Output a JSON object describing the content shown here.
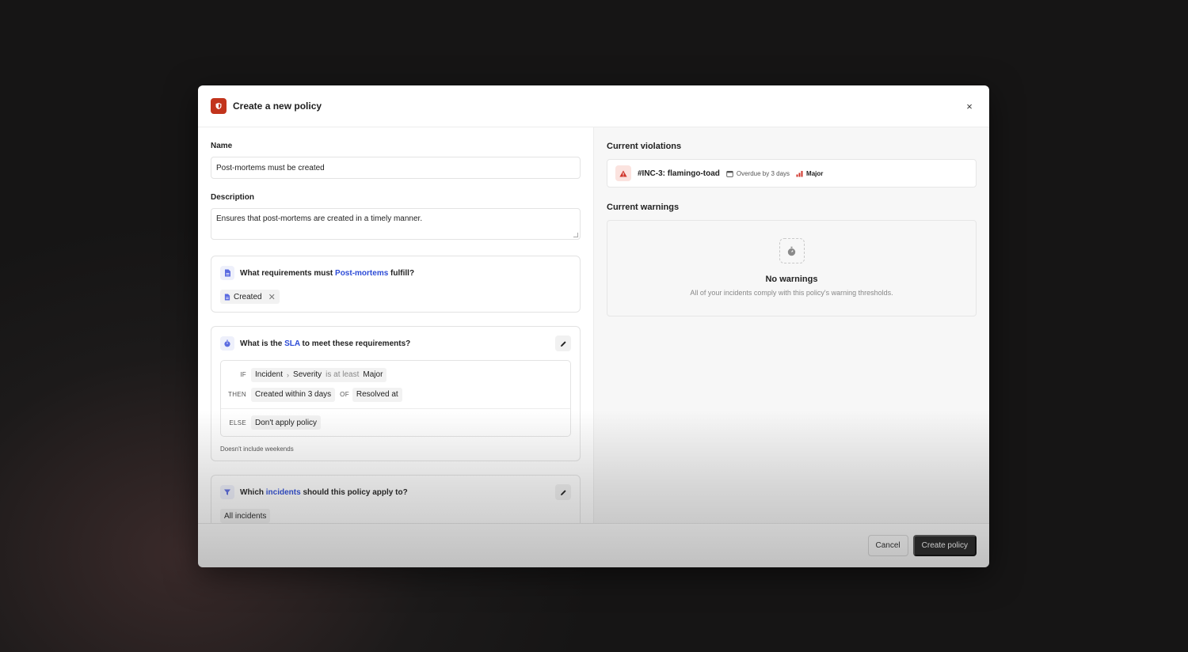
{
  "modal": {
    "title": "Create a new policy",
    "close_label": "×"
  },
  "form": {
    "name_label": "Name",
    "name_value": "Post-mortems must be created",
    "description_label": "Description",
    "description_value": "Ensures that post-mortems are created in a timely manner."
  },
  "requirements": {
    "title_prefix": "What requirements must ",
    "title_link": "Post-mortems",
    "title_suffix": " fulfill?",
    "chip": "Created"
  },
  "sla": {
    "title_prefix": "What is the ",
    "title_link": "SLA",
    "title_suffix": " to meet these requirements?",
    "if_kw": "IF",
    "if_field": "Incident",
    "if_subfield": "Severity",
    "if_operator": "is at least",
    "if_value": "Major",
    "then_kw": "THEN",
    "then_value": "Created within 3 days",
    "of_kw": "OF",
    "of_value": "Resolved at",
    "else_kw": "ELSE",
    "else_value": "Don't apply policy",
    "footnote": "Doesn't include weekends"
  },
  "scope": {
    "title_prefix": "Which ",
    "title_link": "incidents",
    "title_suffix": " should this policy apply to?",
    "value": "All incidents"
  },
  "violations": {
    "title": "Current violations",
    "items": [
      {
        "name": "#INC-3: flamingo-toad",
        "due": "Overdue by 3 days",
        "severity": "Major"
      }
    ]
  },
  "warnings": {
    "title": "Current warnings",
    "empty_title": "No warnings",
    "empty_desc": "All of your incidents comply with this policy's warning thresholds."
  },
  "footer": {
    "cancel_label": "Cancel",
    "create_label": "Create policy"
  },
  "colors": {
    "brand": "#c2341c",
    "link": "#2c4bd6",
    "primary_button": "#1d1d1d",
    "severity": "#d0352b"
  }
}
